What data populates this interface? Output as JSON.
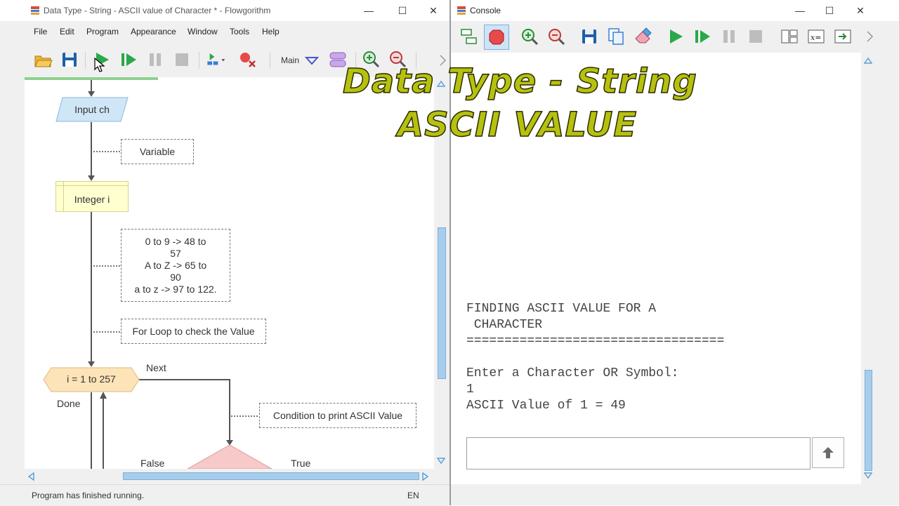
{
  "left_window": {
    "title": "Data Type - String - ASCII value of  Character * - Flowgorithm",
    "icon": "flowgorithm-logo-icon",
    "menu": [
      "File",
      "Edit",
      "Program",
      "Appearance",
      "Window",
      "Tools",
      "Help"
    ],
    "toolbar": {
      "function_selector": "Main"
    },
    "flowchart": {
      "input_label": "Input ch",
      "declare_label": "Integer i",
      "comment_variable": "Variable",
      "comment_ascii": [
        "0 to 9  -> 48 to",
        "57",
        "A to Z  -> 65 to",
        "90",
        "a to z  -> 97 to 122."
      ],
      "comment_loop": "For Loop to check the Value",
      "loop_label": "i = 1 to 257",
      "next_label": "Next",
      "done_label": "Done",
      "comment_condition": "Condition to print ASCII Value",
      "false_label": "False",
      "true_label": "True"
    },
    "status": {
      "message": "Program has finished running.",
      "language": "EN"
    }
  },
  "right_window": {
    "title": "Console",
    "icon": "flowgorithm-logo-icon",
    "console_lines": [
      "FINDING ASCII VALUE FOR A",
      " CHARACTER",
      "==================================",
      "",
      "Enter a Character OR Symbol:",
      "1",
      "ASCII Value of 1 = 49"
    ],
    "input_value": ""
  },
  "overlay": {
    "line1": "Data Type - String",
    "line2": "ASCII VALUE"
  },
  "colors": {
    "overlay_text": "#b6c10f",
    "input_shape": "#cfe6f7",
    "declare_shape": "#ffffd0",
    "loop_shape": "#fde3b8",
    "if_shape": "#f7c9c9",
    "run_green": "#2aa84a",
    "stop_red": "#e8494a"
  }
}
